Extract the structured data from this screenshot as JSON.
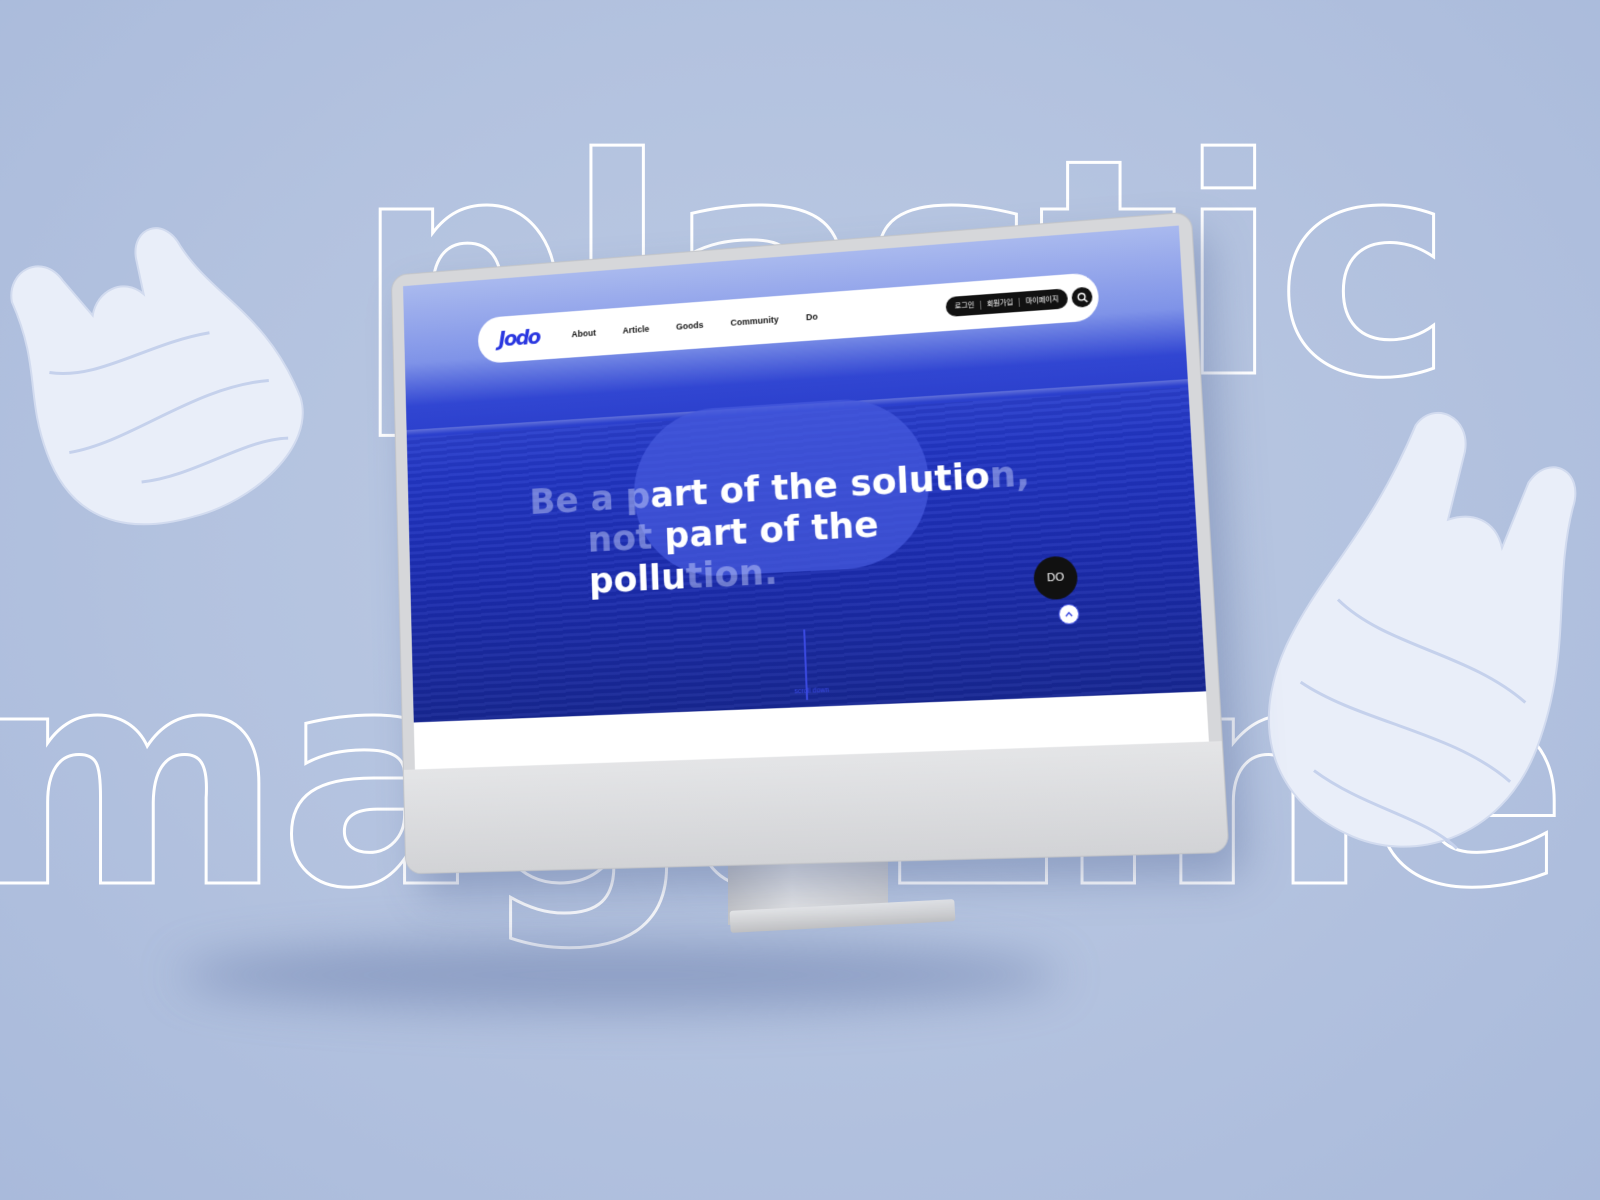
{
  "background": {
    "word_top": "plastic",
    "word_bottom": "magazine",
    "color": "#b3c2df"
  },
  "site": {
    "logo": "Jodo",
    "nav": [
      "About",
      "Article",
      "Goods",
      "Community",
      "Do"
    ],
    "util_links": [
      "로그인",
      "회원가입",
      "마이페이지"
    ],
    "search_icon": "search-icon",
    "hero": {
      "line1_faint": "Be a p",
      "line1_strong": "art of the solutio",
      "line1_tail": "n,",
      "line2_faint": "not ",
      "line2_strong": "part of the pollu",
      "line2_tail": "tion."
    },
    "do_button": "DO",
    "scroll_label": "scroll down",
    "accent_color": "#2a37e0"
  }
}
